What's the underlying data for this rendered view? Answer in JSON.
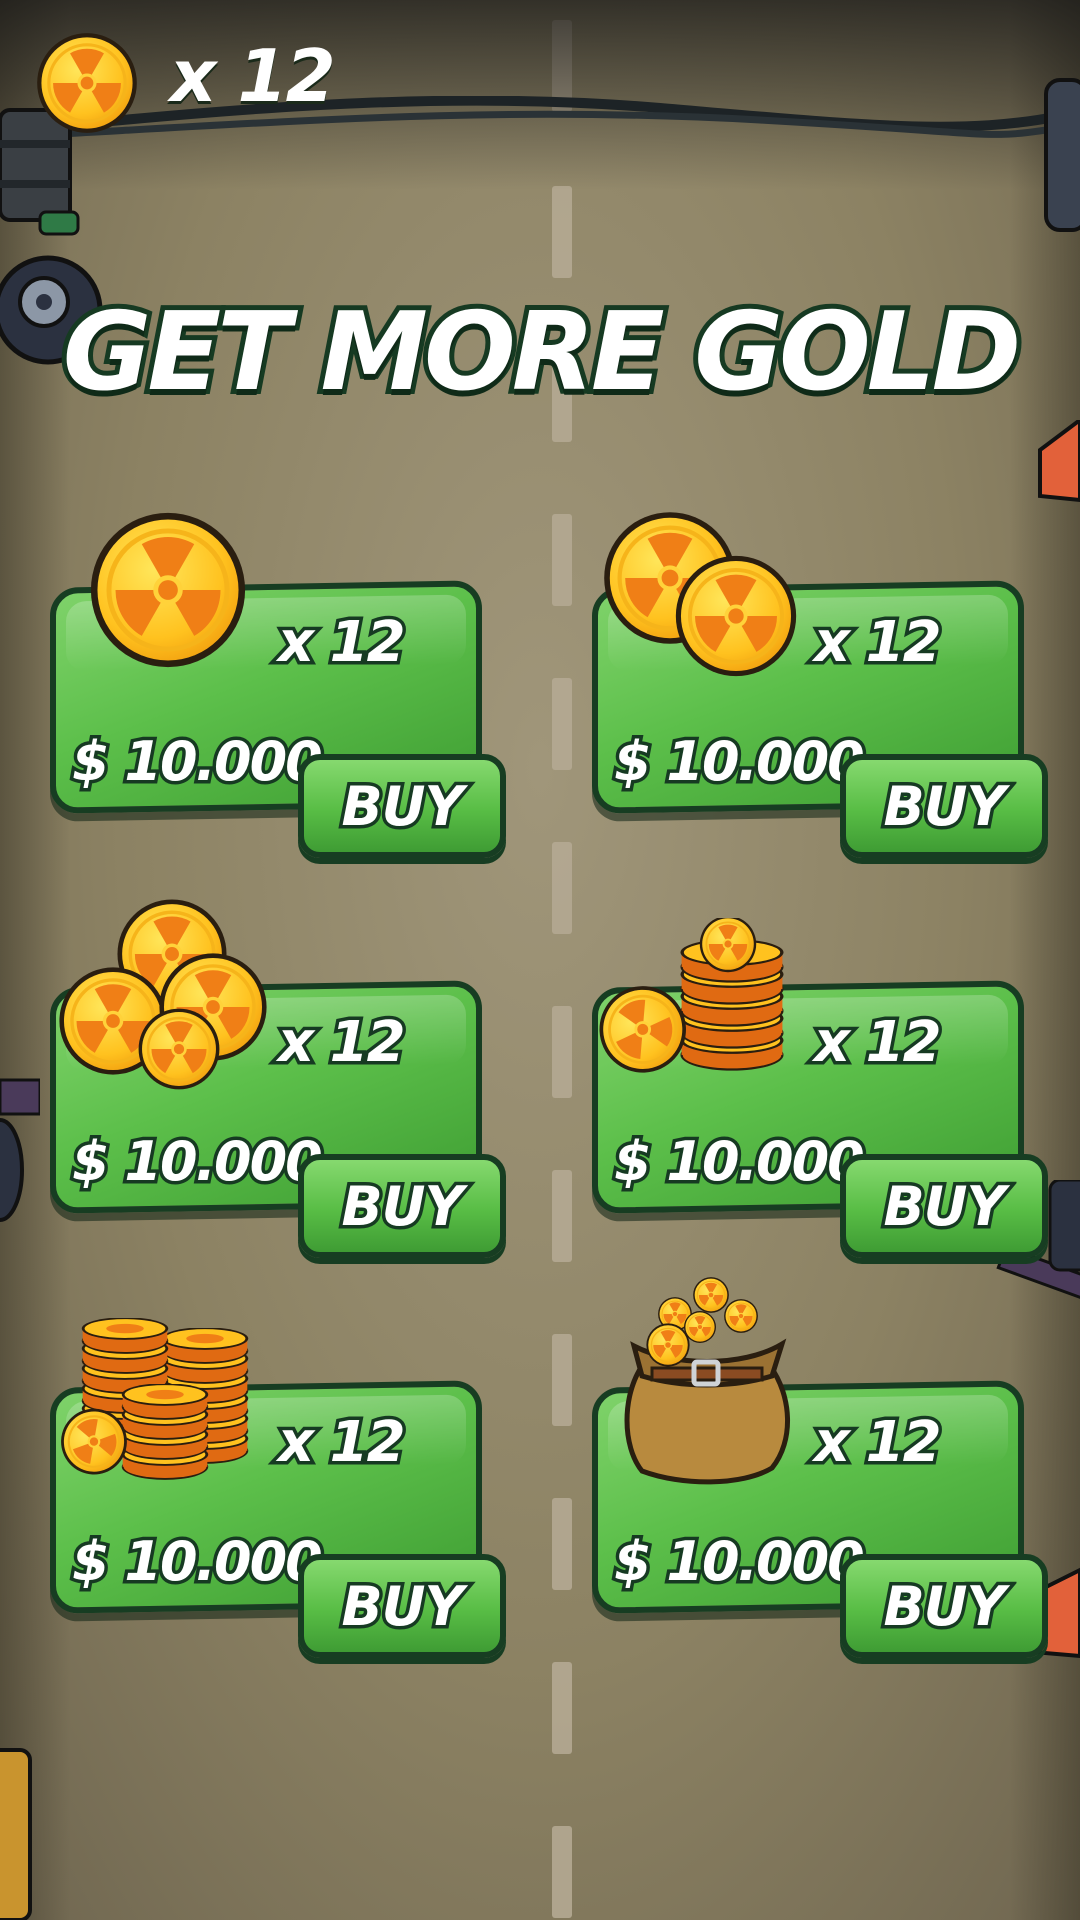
{
  "header": {
    "currency_icon": "radiation-coin-icon",
    "count": "x 12"
  },
  "title": "GET MORE GOLD",
  "colors": {
    "panel_green": "#5cbf4a",
    "outline": "#163a22",
    "coin_gold": "#ffd23a",
    "coin_orange": "#f08a1c",
    "road": "#8f8566"
  },
  "offers": [
    {
      "art": "single-coin-icon",
      "quantity": "x 12",
      "price": "$ 10.000",
      "buy_label": "BUY"
    },
    {
      "art": "two-coins-icon",
      "quantity": "x 12",
      "price": "$ 10.000",
      "buy_label": "BUY"
    },
    {
      "art": "coin-pile-icon",
      "quantity": "x 12",
      "price": "$ 10.000",
      "buy_label": "BUY"
    },
    {
      "art": "coin-stack-icon",
      "quantity": "x 12",
      "price": "$ 10.000",
      "buy_label": "BUY"
    },
    {
      "art": "coin-stacks-icon",
      "quantity": "x 12",
      "price": "$ 10.000",
      "buy_label": "BUY"
    },
    {
      "art": "coin-sack-icon",
      "quantity": "x 12",
      "price": "$ 10.000",
      "buy_label": "BUY"
    }
  ]
}
